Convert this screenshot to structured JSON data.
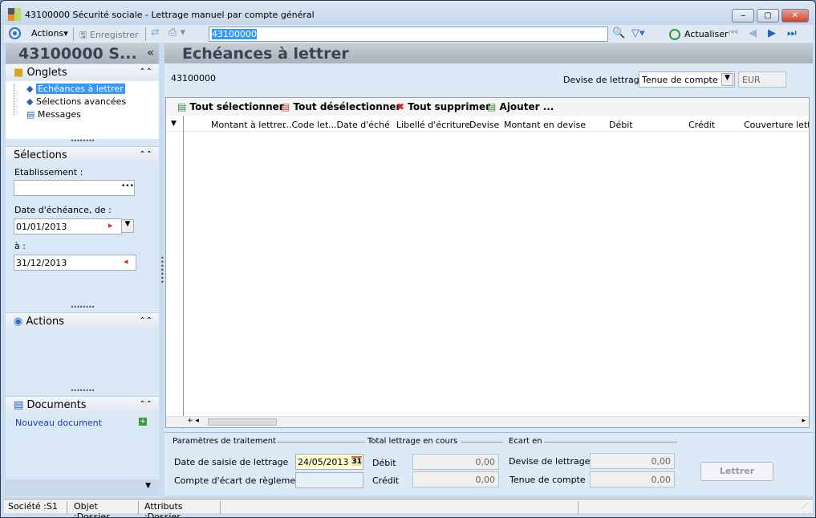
{
  "window": {
    "title": "43100000 Sécurité sociale -  Lettrage manuel par compte général",
    "min": "‒",
    "max": "▢",
    "close": "✕"
  },
  "toolbar": {
    "actions": "Actions",
    "save": "Enregistrer",
    "search_value": "43100000",
    "refresh": "Actualiser"
  },
  "left": {
    "header": "43100000 S...",
    "collapse": "«",
    "onglets": {
      "title": "Onglets",
      "items": [
        "Echéances à lettrer",
        "Sélections avancées",
        "Messages"
      ]
    },
    "selections": {
      "title": "Sélections",
      "etablissement_label": "Etablissement :",
      "etablissement_value": "",
      "date_from_label": "Date d'échéance, de :",
      "date_from": "01/01/2013",
      "date_to_label": "à :",
      "date_to": "31/12/2013"
    },
    "actions": {
      "title": "Actions"
    },
    "documents": {
      "title": "Documents",
      "new": "Nouveau document"
    }
  },
  "main": {
    "title": "Echéances à lettrer",
    "account": "43100000",
    "devise_label": "Devise de lettrage :",
    "devise_value": "Tenue de compte",
    "currency": "EUR",
    "grid_actions": [
      "Tout sélectionner",
      "Tout désélectionner",
      "Tout supprimer",
      "Ajouter ..."
    ],
    "columns": [
      "Montant à lettrer",
      "...Code let",
      "...Date d'éché",
      "Libellé d'écriture",
      "Devise",
      "Montant en devise",
      "Débit",
      "Crédit",
      "Couverture lettra"
    ]
  },
  "footer": {
    "params_title": "Paramètres de traitement",
    "date_label": "Date de saisie de lettrage",
    "date_value": "24/05/2013",
    "ecart_label": "Compte d'écart de règlement",
    "ecart_value": "",
    "total_title": "Total lettrage en cours",
    "debit_label": "Débit",
    "debit": "0,00",
    "credit_label": "Crédit",
    "credit": "0,00",
    "ecart_title": "Ecart en",
    "devise_label": "Devise de lettrage",
    "devise": "0,00",
    "tenue_label": "Tenue de compte",
    "tenue": "0,00",
    "lettrer": "Lettrer"
  },
  "status": {
    "societe": "Société :S1",
    "objet": "Objet :Dossier",
    "attributs": "Attributs :Dossier"
  }
}
